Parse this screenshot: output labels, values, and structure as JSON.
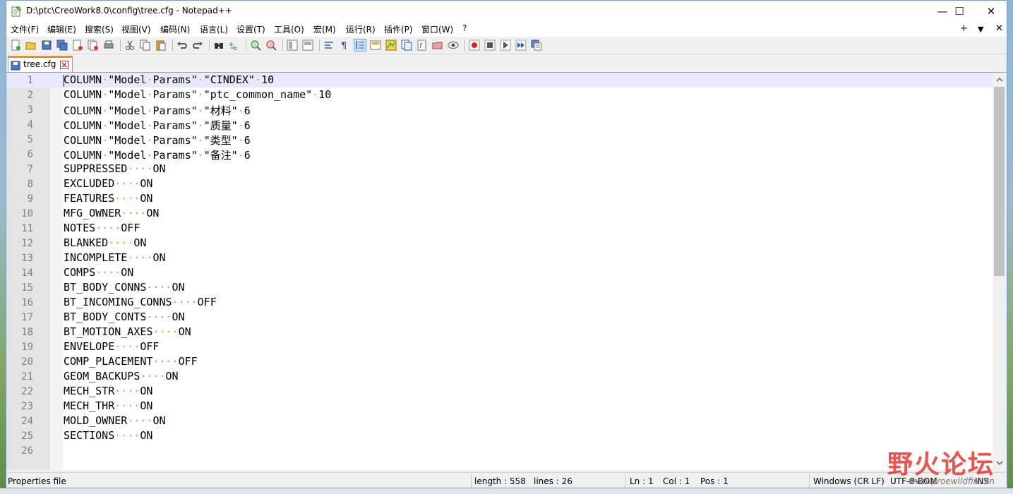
{
  "window": {
    "title": "D:\\ptc\\CreoWork8.0\\config\\tree.cfg - Notepad++",
    "minimize_glyph": "—",
    "maximize_glyph": "☐",
    "close_glyph": "✕"
  },
  "menu": {
    "items": [
      "文件(F)",
      "编辑(E)",
      "搜索(S)",
      "视图(V)",
      "编码(N)",
      "语言(L)",
      "设置(T)",
      "工具(O)",
      "宏(M)",
      "运行(R)",
      "插件(P)",
      "窗口(W)",
      "?"
    ],
    "right_plus": "+",
    "right_arrow": "▼",
    "right_close": "✕"
  },
  "tab": {
    "label": "tree.cfg"
  },
  "editor": {
    "current_line": 1,
    "lines": [
      {
        "n": "1",
        "text": "COLUMN·\"Model·Params\"·\"CINDEX\"·10"
      },
      {
        "n": "2",
        "text": "COLUMN·\"Model·Params\"·\"ptc_common_name\"·10"
      },
      {
        "n": "3",
        "text": "COLUMN·\"Model·Params\"·\"材料\"·6"
      },
      {
        "n": "4",
        "text": "COLUMN·\"Model·Params\"·\"质量\"·6"
      },
      {
        "n": "5",
        "text": "COLUMN·\"Model·Params\"·\"类型\"·6"
      },
      {
        "n": "6",
        "text": "COLUMN·\"Model·Params\"·\"备注\"·6"
      },
      {
        "n": "7",
        "text": "SUPPRESSED····ON"
      },
      {
        "n": "8",
        "text": "EXCLUDED····ON"
      },
      {
        "n": "9",
        "text": "FEATURES····ON"
      },
      {
        "n": "10",
        "text": "MFG_OWNER····ON"
      },
      {
        "n": "11",
        "text": "NOTES····OFF"
      },
      {
        "n": "12",
        "text": "BLANKED····ON"
      },
      {
        "n": "13",
        "text": "INCOMPLETE····ON"
      },
      {
        "n": "14",
        "text": "COMPS····ON"
      },
      {
        "n": "15",
        "text": "BT_BODY_CONNS····ON"
      },
      {
        "n": "16",
        "text": "BT_INCOMING_CONNS····OFF"
      },
      {
        "n": "17",
        "text": "BT_BODY_CONTS····ON"
      },
      {
        "n": "18",
        "text": "BT_MOTION_AXES····ON"
      },
      {
        "n": "19",
        "text": "ENVELOPE····OFF"
      },
      {
        "n": "20",
        "text": "COMP_PLACEMENT····OFF"
      },
      {
        "n": "21",
        "text": "GEOM_BACKUPS····ON"
      },
      {
        "n": "22",
        "text": "MECH_STR····ON"
      },
      {
        "n": "23",
        "text": "MECH_THR····ON"
      },
      {
        "n": "24",
        "text": "MOLD_OWNER····ON"
      },
      {
        "n": "25",
        "text": "SECTIONS····ON"
      },
      {
        "n": "26",
        "text": ""
      }
    ]
  },
  "status": {
    "file_type": "Properties file",
    "length": "length : 558",
    "lines": "lines : 26",
    "ln": "Ln : 1",
    "col": "Col : 1",
    "pos": "Pos : 1",
    "eol": "Windows (CR LF)",
    "encoding": "UTF-8-BOM",
    "mode": "INS"
  },
  "watermark": {
    "text": "野火论坛",
    "url": "www.proewildfire.cn"
  },
  "toolbar_icons": [
    "new-file-icon",
    "open-file-icon",
    "save-icon",
    "save-all-icon",
    "close-icon",
    "close-all-icon",
    "print-icon",
    "cut-icon",
    "copy-icon",
    "paste-icon",
    "undo-icon",
    "redo-icon",
    "find-icon",
    "replace-icon",
    "zoom-in-icon",
    "zoom-out-icon",
    "sync-vertical-icon",
    "sync-horizontal-icon",
    "word-wrap-icon",
    "show-all-chars-icon",
    "indent-guide-icon",
    "udl-icon",
    "doc-map-icon",
    "function-list-icon",
    "folder-as-workspace-icon",
    "monitor-icon",
    "record-macro-icon",
    "stop-macro-icon",
    "play-macro-icon",
    "run-macro-multiple-icon",
    "save-macro-icon"
  ],
  "colors": {
    "accent_tab": "#fa8c00",
    "current_line": "#e8e8ff",
    "gutter": "#e4e4e4",
    "whitespace_dot": "#ff8c3c"
  }
}
